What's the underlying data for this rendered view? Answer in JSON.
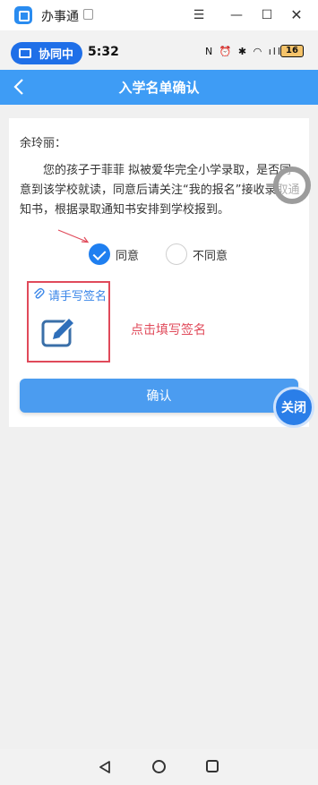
{
  "window": {
    "app_title": "办事通",
    "menu_glyph": "☰",
    "min_glyph": "—",
    "max_glyph": "☐",
    "close_glyph": "✕"
  },
  "statusbar": {
    "collab_label": "协同中",
    "time": "5:32",
    "icons_text": "N ⏰ ✱ ◠ ıll",
    "battery": "16"
  },
  "header": {
    "title": "入学名单确认"
  },
  "content": {
    "greeting": "余玲丽：",
    "message": "您的孩子于菲菲 拟被爱华完全小学录取，是否同意到该学校就读，同意后请关注“我的报名”接收录取通知书，根据录取通知书安排到学校报到。",
    "options": {
      "agree": "同意",
      "disagree": "不同意",
      "selected": "agree"
    },
    "sign_label": "请手写签名",
    "hint": "点击填写签名",
    "confirm_label": "确认",
    "close_label": "关闭"
  },
  "colors": {
    "header_bg": "#3e9cf5",
    "accent": "#1f7ff0",
    "annotation_red": "#e04a5a",
    "confirm_bg": "#4b9cf0"
  },
  "icons": {
    "back": "chevron-left-icon",
    "sign": "pen-on-pad-icon",
    "clip": "paperclip-icon"
  }
}
